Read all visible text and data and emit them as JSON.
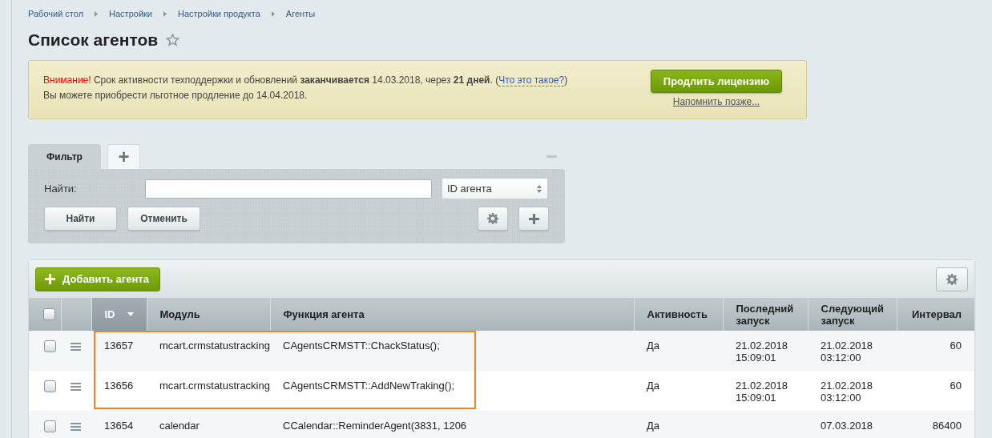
{
  "breadcrumbs": [
    "Рабочий стол",
    "Настройки",
    "Настройки продукта",
    "Агенты"
  ],
  "title": "Список агентов",
  "notice": {
    "warning": "Внимание!",
    "text": "Срок активности техподдержки и обновлений **заканчивается** 14.03.2018, через **21 дней**. (",
    "link": "Что это такое?",
    "after": ")",
    "line2": "Вы можете приобрести льготное продление до 14.04.2018.",
    "button": "Продлить лицензию",
    "remind": "Напомнить позже..."
  },
  "filter": {
    "tabs": [
      {
        "label": "Фильтр",
        "selected": true,
        "kind": "text"
      },
      {
        "label": "+",
        "selected": false,
        "kind": "add"
      }
    ],
    "find_label": "Найти:",
    "field_select": "ID агента",
    "buttons": [
      "Найти",
      "Отменить"
    ]
  },
  "grid": {
    "add_button": "Добавить агента",
    "header_checked": false,
    "columns": [
      {
        "label": "ID",
        "sorted": true
      },
      {
        "label": "Модуль",
        "sorted": false
      },
      {
        "label": "Функция агента",
        "sorted": false
      },
      {
        "label": "Активность",
        "sorted": false
      },
      {
        "label": "Последний запуск",
        "sorted": false
      },
      {
        "label": "Следующий запуск",
        "sorted": false
      },
      {
        "label": "Интервал",
        "sorted": false
      }
    ],
    "rows": [
      {
        "checked": false,
        "highlighted": true,
        "cells": [
          "13657",
          "mcart.crmstatustracking",
          "CAgentsCRMSTT::ChackStatus();",
          "Да",
          "21.02.2018 15:09:01",
          "21.02.2018 03:12:00",
          "60"
        ]
      },
      {
        "checked": false,
        "highlighted": true,
        "cells": [
          "13656",
          "mcart.crmstatustracking",
          "CAgentsCRMSTT::AddNewTraking();",
          "Да",
          "21.02.2018 15:09:01",
          "21.02.2018 03:12:00",
          "60"
        ]
      },
      {
        "checked": false,
        "highlighted": false,
        "cells": [
          "13654",
          "calendar",
          "CCalendar::ReminderAgent(3831, 1206",
          "Да",
          "",
          "07.03.2018",
          "86400"
        ]
      }
    ]
  }
}
